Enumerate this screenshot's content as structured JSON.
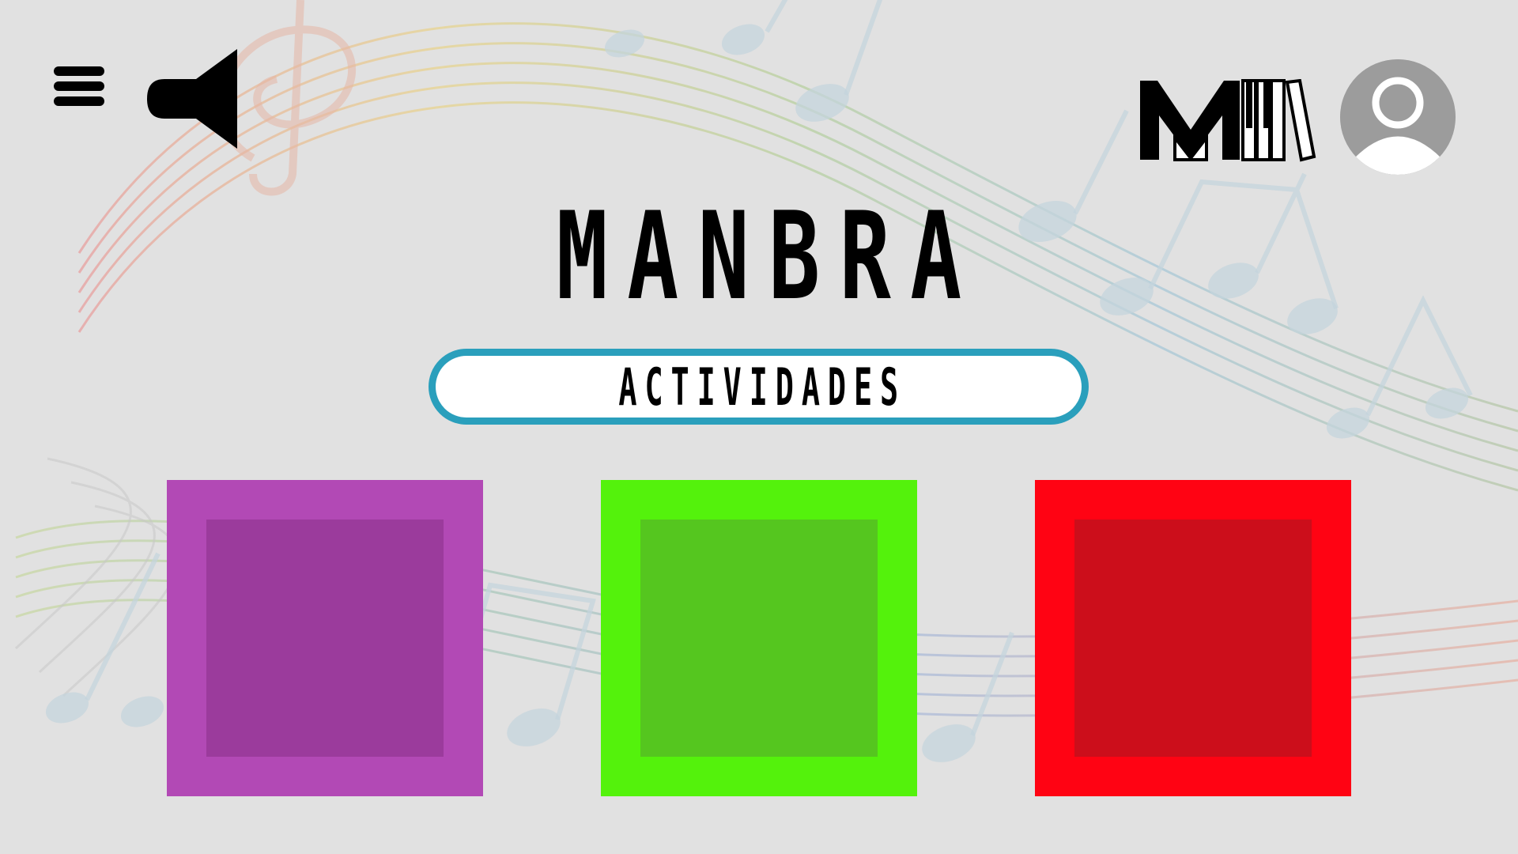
{
  "app": {
    "title": "MANBRA"
  },
  "header": {
    "menu_icon": "hamburger-menu-icon",
    "sound_icon": "speaker-icon",
    "logo_icon": "manbra-logo",
    "profile_icon": "user-avatar-icon"
  },
  "section": {
    "label": "ACTIVIDADES",
    "border_color": "#2a9fbc"
  },
  "tiles": [
    {
      "outer_color": "#b249b5",
      "inner_color": "#9b3b9c"
    },
    {
      "outer_color": "#54f20c",
      "inner_color": "#55c61f"
    },
    {
      "outer_color": "#ff0313",
      "inner_color": "#cc0e1b"
    }
  ]
}
